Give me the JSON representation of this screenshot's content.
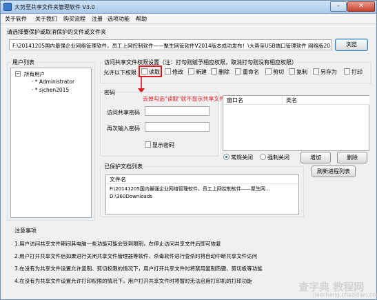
{
  "window": {
    "title": "大势至共享文件夹管理软件 V3.0",
    "minimize": "–",
    "close": "✕"
  },
  "menu": [
    "关于软件",
    "关于我们",
    "购买流程",
    "注册",
    "选项功能",
    "帮助"
  ],
  "select_prompt": "请选择要保护或取消保护的文件或文件夹",
  "path_value": "F:\\20141205国内最强企业网络管理软件，员工上网控制软件——聚生网管软件V2014版本成功发布！\\大势至USB端口管理软件 网络版20",
  "browse_label": "浏览",
  "users": {
    "title": "用户列表",
    "root": "所有用户",
    "children": [
      "Administrator",
      "sjchen2015"
    ]
  },
  "perm": {
    "title": "访问共享文件权限设置（注：打勾则赋予相应权限，取消打勾则没有相应权限）",
    "allow_label": "允许以下权限",
    "options": [
      "读取",
      "修改",
      "新建",
      "删除",
      "重命名",
      "剪切",
      "复制",
      "另存为",
      "打印"
    ]
  },
  "annotation": "去掉勾选\"读取\"就不显示共享文件了",
  "password": {
    "title": "密码",
    "access_label": "访问共享密码",
    "confirm_label": "再次输入密码",
    "show_label": "显示密码"
  },
  "window_list": {
    "col1": "窗口名",
    "col2": "类名"
  },
  "radios": [
    "常规关闭",
    "强制关闭"
  ],
  "buttons": {
    "add": "增加",
    "delete": "删除",
    "refresh": "刷新进程列表"
  },
  "protected": {
    "title": "已保护文档列表",
    "column": "文件名",
    "rows": [
      "F:\\20141205国内最强企业网络管理软件，员工上网控制软件——聚生网...",
      "D:\\360Downloads"
    ]
  },
  "notes": {
    "title": "注意事项",
    "items": [
      "1.用户访问共享文件期间其电脑一些功能可能会受到限制，在停止访问共享文件后即可恢复",
      "2.用户打开共享文件后如果进行关闭共享文件管理器等软件、杀毒软件进行查杀时将自动中断共享文件访问",
      "3.在没有为共享文件设置允许复制、剪切权限的情况下，用户打开共享文件时将禁用复制热键、剪切板等功能",
      "4.在没有为共享文件设置允许打印权限的情况下，用户打开共享文件时将暂时无法启用打印机的打印功能"
    ]
  },
  "watermark": {
    "main": "查字典 教程网",
    "sub": "jiaocheng.chazidian.com"
  }
}
